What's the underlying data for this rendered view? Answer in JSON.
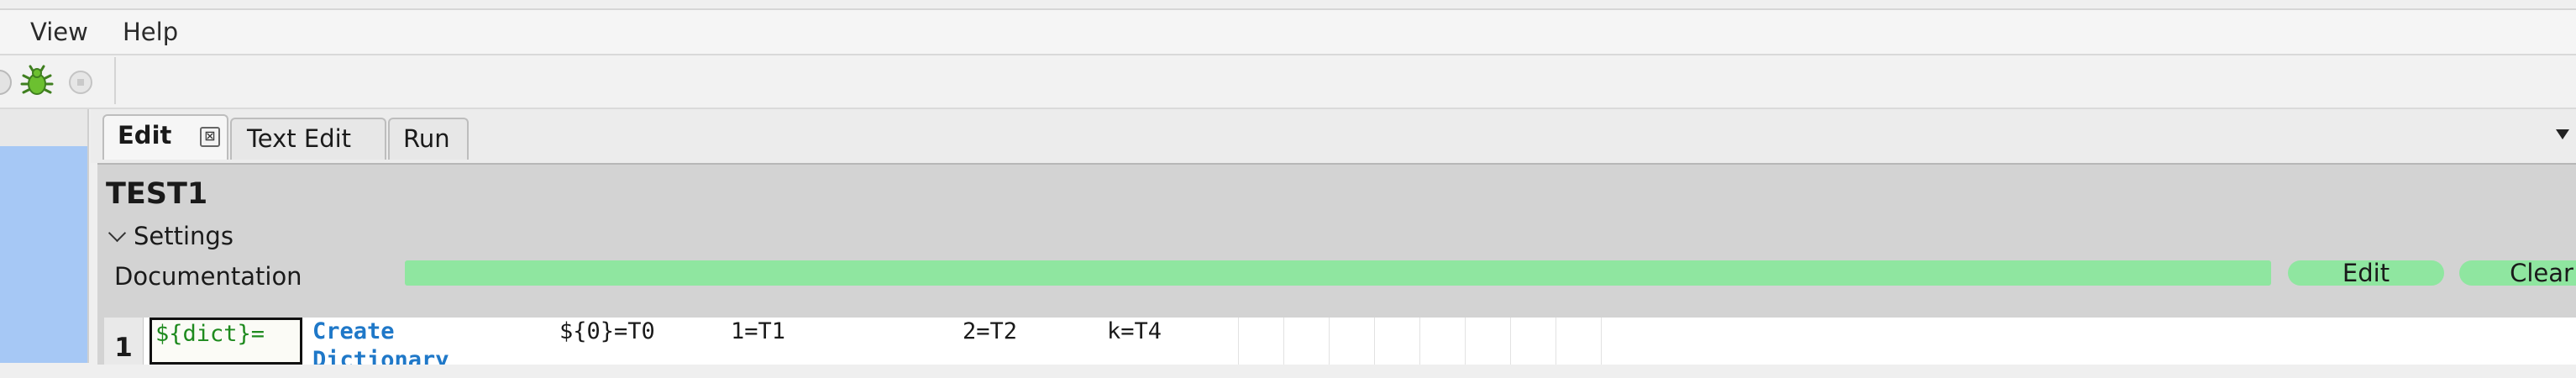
{
  "menubar": {
    "items": [
      "View",
      "Help"
    ]
  },
  "toolbar": {
    "icons": [
      "partial-icon",
      "bug-icon",
      "stop-icon"
    ]
  },
  "tabs": [
    {
      "label": "Edit",
      "active": true,
      "close_glyph": "⊠"
    },
    {
      "label": "Text Edit",
      "active": false
    },
    {
      "label": "Run",
      "active": false
    }
  ],
  "editor": {
    "title": "TEST1",
    "settings_label": "Settings",
    "documentation_label": "Documentation",
    "edit_label": "Edit",
    "clear_label": "Clear",
    "row": {
      "number": "1",
      "cells": [
        "${dict}=",
        "Create Dictionary",
        "${0}=T0",
        "1=T1",
        "2=T2",
        "k=T4"
      ]
    }
  },
  "colors": {
    "doc_bar": "#8fe6a0",
    "left_panel": "#a6c8f5",
    "keyword": "#1f78c8",
    "variable": "#1e8a1e"
  }
}
